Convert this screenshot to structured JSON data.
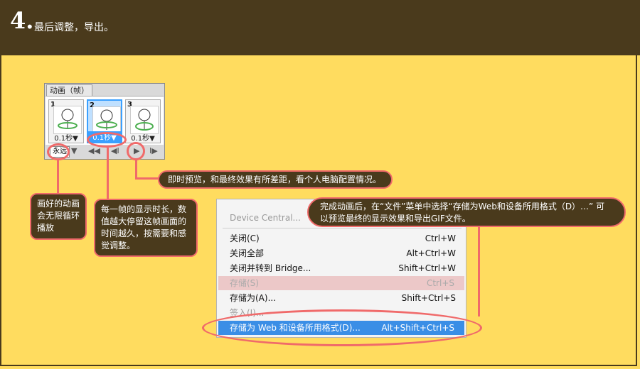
{
  "header": {
    "step_number": "4.",
    "title": "最后调整，导出。"
  },
  "anim_panel": {
    "tab_label": "动画（帧）",
    "frames": [
      {
        "number": "1",
        "delay": "0.1秒▼"
      },
      {
        "number": "2",
        "delay": "0.1秒▼"
      },
      {
        "number": "3",
        "delay": "0.1秒▼"
      }
    ],
    "loop_value": "永远",
    "controls": {
      "dropdown": "▼",
      "first": "◀◀",
      "prev": "◀I",
      "play": "▶",
      "next": "I▶"
    }
  },
  "callouts": {
    "preview": "即时预览，和最终效果有所差距，看个人电脑配置情况。",
    "loop": "画好的动画会无限循环播放",
    "delay": "每一帧的显示时长，数值越大停留这帧画面的时间越久，按需要和感觉调整。",
    "save": "完成动画后，在“文件”菜单中选择“存储为Web和设备所用格式（D）…” 可以预览最终的显示效果和导出GIF文件。"
  },
  "menu": {
    "items": [
      {
        "label": "Device Central...",
        "shortcut": ""
      },
      {
        "label": "关闭(C)",
        "shortcut": "Ctrl+W"
      },
      {
        "label": "关闭全部",
        "shortcut": "Alt+Ctrl+W"
      },
      {
        "label": "关闭并转到 Bridge...",
        "shortcut": "Shift+Ctrl+W"
      },
      {
        "label": "存储(S)",
        "shortcut": "Ctrl+S"
      },
      {
        "label": "存储为(A)...",
        "shortcut": "Shift+Ctrl+S"
      },
      {
        "label": "签入(I)...",
        "shortcut": ""
      },
      {
        "label": "存储为 Web 和设备所用格式(D)...",
        "shortcut": "Alt+Shift+Ctrl+S"
      }
    ]
  },
  "colors": {
    "header_bg": "#4a3a1c",
    "page_bg": "#ffdc5f",
    "accent": "#f06a6a",
    "selection": "#3a8ee6"
  }
}
